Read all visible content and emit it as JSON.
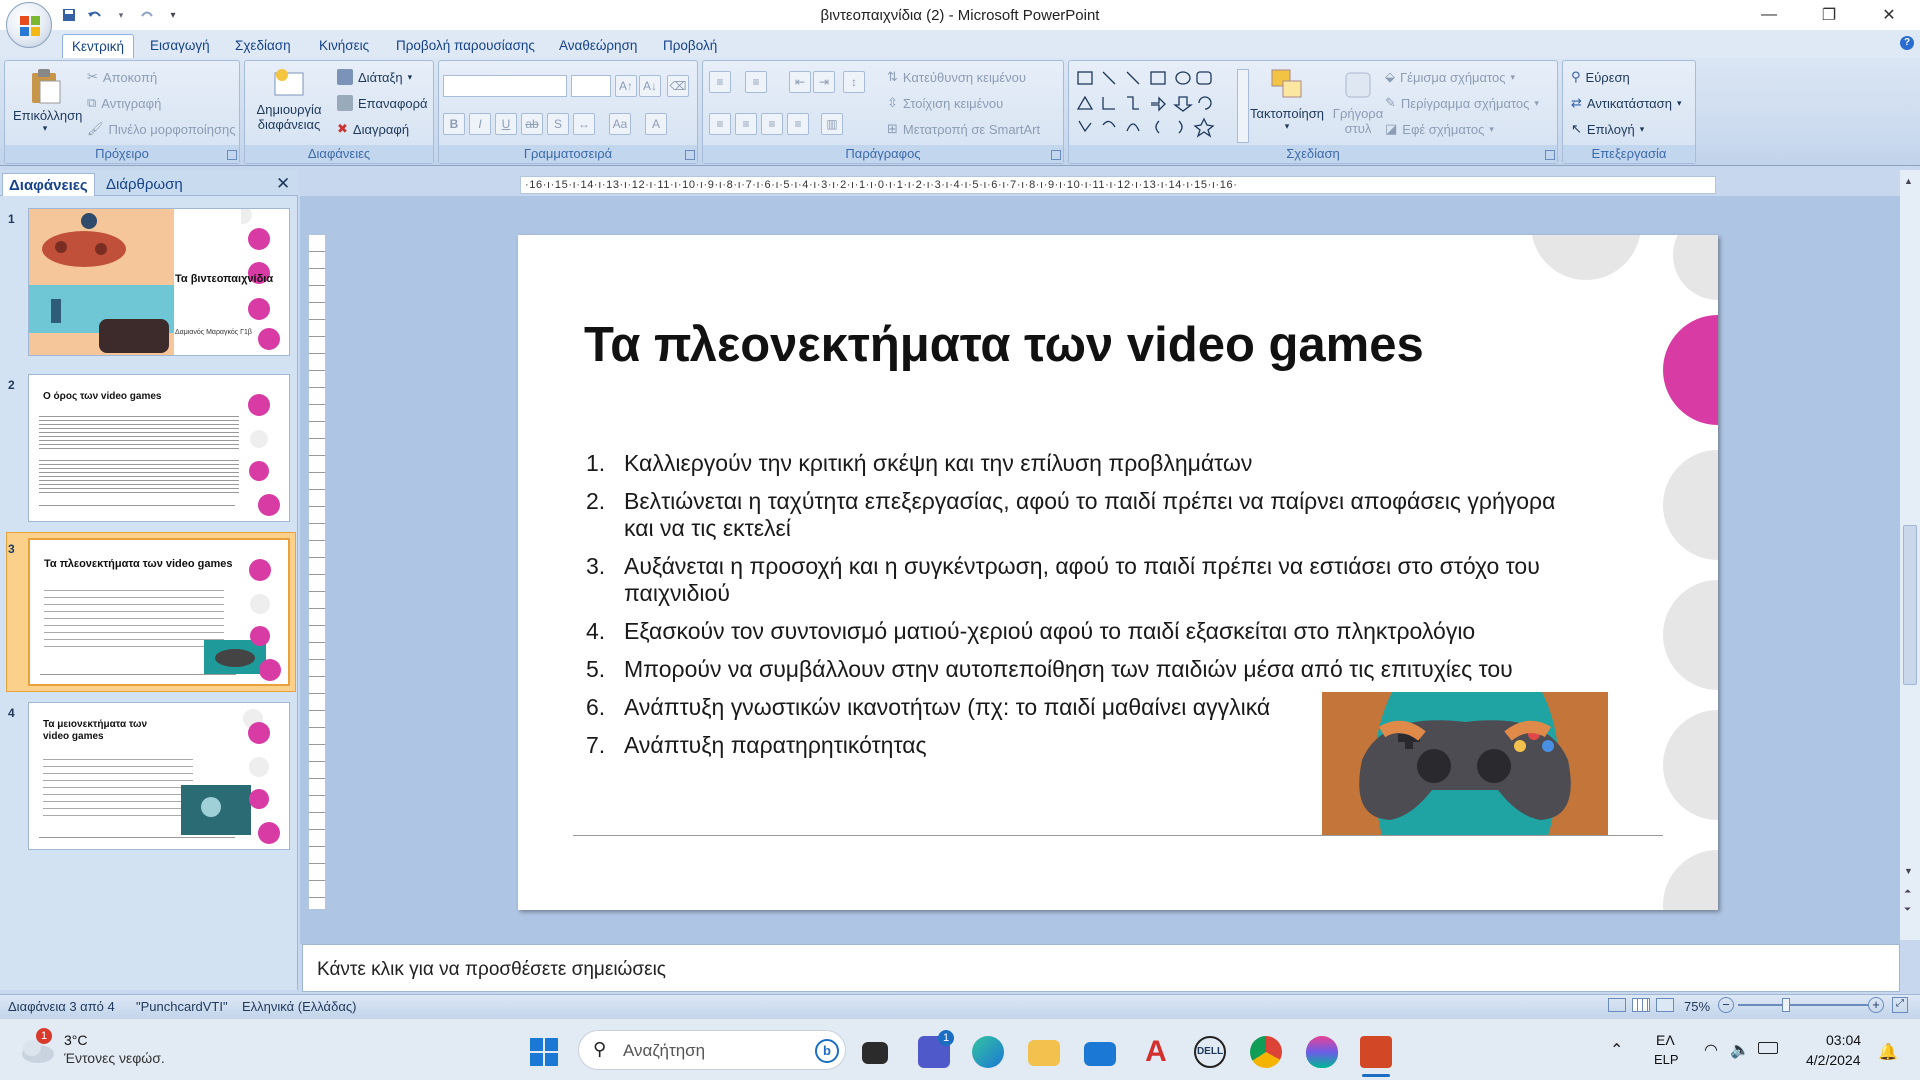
{
  "window": {
    "title": "βιντεοπαιχνίδια (2) - Microsoft PowerPoint",
    "minimize": "—",
    "restore": "❐",
    "close": "✕"
  },
  "ribbon_tabs": [
    "Κεντρική",
    "Εισαγωγή",
    "Σχεδίαση",
    "Κινήσεις",
    "Προβολή παρουσίασης",
    "Αναθεώρηση",
    "Προβολή"
  ],
  "ribbon": {
    "clipboard": {
      "label": "Πρόχειρο",
      "paste": "Επικόλληση",
      "cut": "Αποκοπή",
      "copy": "Αντιγραφή",
      "format_painter": "Πινέλο μορφοποίησης"
    },
    "slides": {
      "label": "Διαφάνειες",
      "new_slide": "Δημιουργία διαφάνειας",
      "layout": "Διάταξη",
      "reset": "Επαναφορά",
      "delete": "Διαγραφή"
    },
    "font": {
      "label": "Γραμματοσειρά"
    },
    "paragraph": {
      "label": "Παράγραφος",
      "text_direction": "Κατεύθυνση κειμένου",
      "align_text": "Στοίχιση κειμένου",
      "smartart": "Μετατροπή σε SmartArt"
    },
    "drawing": {
      "label": "Σχεδίαση",
      "arrange": "Τακτοποίηση",
      "quick_styles": "Γρήγορα στυλ",
      "fill": "Γέμισμα σχήματος",
      "outline": "Περίγραμμα σχήματος",
      "effects": "Εφέ σχήματος"
    },
    "editing": {
      "label": "Επεξεργασία",
      "find": "Εύρεση",
      "replace": "Αντικατάσταση",
      "select": "Επιλογή"
    }
  },
  "panel": {
    "tab_slides": "Διαφάνειες",
    "tab_outline": "Διάρθρωση",
    "close": "✕",
    "thumbs": [
      {
        "num": "1",
        "title": "Τα βιντεοπαιχνίδια",
        "subtitle": "Δαμιανός Μαραγκός Γ1β"
      },
      {
        "num": "2",
        "title": "Ο όρος των video games"
      },
      {
        "num": "3",
        "title": "Τα πλεονεκτήματα των video games"
      },
      {
        "num": "4",
        "title": "Τα μειονεκτήματα των video games"
      }
    ]
  },
  "ruler_h": "·16·ı·15·ı·14·ı·13·ı·12·ı·11·ı·10·ı·9·ı·8·ı·7·ı·6·ı·5·ı·4·ı·3·ı·2·ı·1·ı·0·ı·1·ı·2·ı·3·ı·4·ı·5·ı·6·ı·7·ı·8·ı·9·ı·10·ı·11·ı·12·ı·13·ı·14·ı·15·ı·16·",
  "slide": {
    "title": "Τα πλεονεκτήματα των video games",
    "items": [
      {
        "n": "1.",
        "text": "Καλλιεργούν την κριτική σκέψη και την επίλυση προβλημάτων"
      },
      {
        "n": "2.",
        "text": "Βελτιώνεται η ταχύτητα επεξεργασίας, αφού το παιδί πρέπει να παίρνει αποφάσεις γρήγορα και να τις εκτελεί"
      },
      {
        "n": "3.",
        "text": "Αυξάνεται η προσοχή και η συγκέντρωση, αφού το παιδί πρέπει να εστιάσει στο στόχο του παιχνιδιού"
      },
      {
        "n": "4.",
        "text": "Εξασκούν τον συντονισμό ματιού-χεριού αφού το παιδί εξασκείται στο πληκτρολόγιο"
      },
      {
        "n": "5.",
        "text": "Μπορούν να συμβάλλουν στην αυτοπεποίθηση των παιδιών μέσα από τις επιτυχίες του"
      },
      {
        "n": "6.",
        "text": "Ανάπτυξη γνωστικών ικανοτήτων (πχ: το παιδί μαθαίνει αγγλικά"
      },
      {
        "n": "7.",
        "text": "Ανάπτυξη παρατηρητικότητας"
      }
    ]
  },
  "notes_placeholder": "Κάντε κλικ για να προσθέσετε σημειώσεις",
  "status": {
    "slide_pos": "Διαφάνεια 3 από 4",
    "theme": "\"PunchcardVTI\"",
    "language": "Ελληνικά (Ελλάδας)",
    "zoom": "75%"
  },
  "taskbar": {
    "weather_temp": "3°C",
    "weather_desc": "Έντονες νεφώσ.",
    "weather_badge": "1",
    "search_placeholder": "Αναζήτηση",
    "teams_badge": "1",
    "lang_top": "ΕΛ",
    "lang_bottom": "ELP",
    "time": "03:04",
    "date": "4/2/2024"
  },
  "colors": {
    "accent_magenta": "#d93ba5",
    "slide_circle": "#e6e6e6",
    "ribbon_blue": "#15428b",
    "selection": "#fbd08a"
  }
}
